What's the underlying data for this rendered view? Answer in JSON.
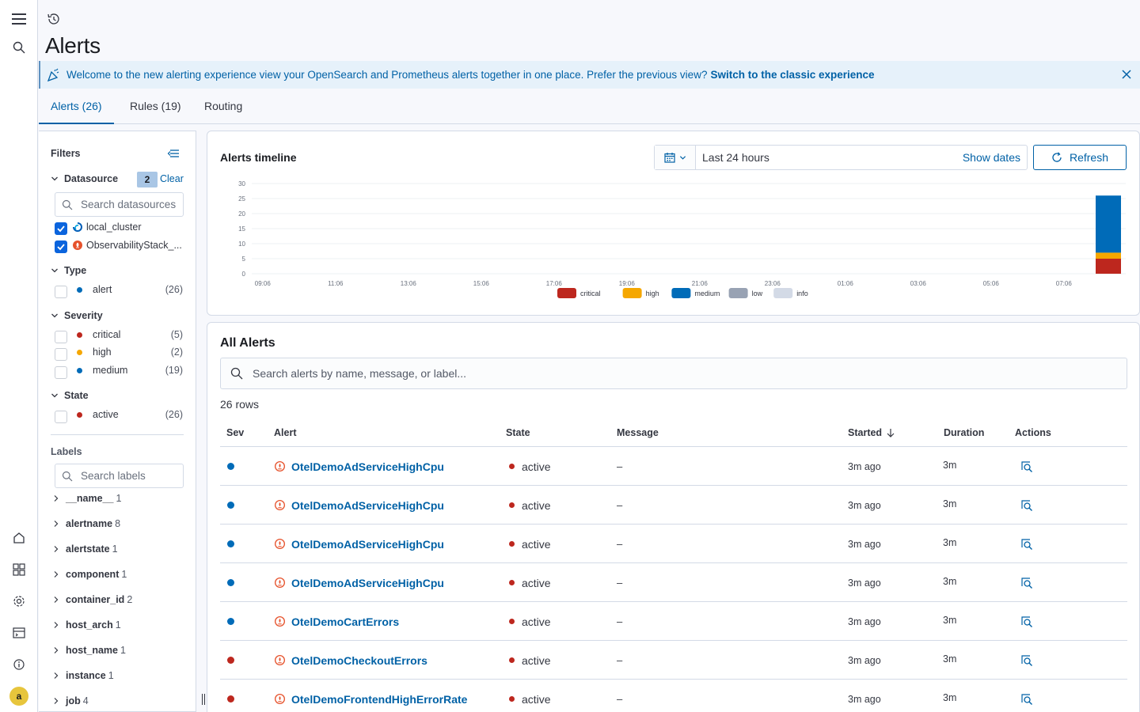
{
  "page": {
    "title": "Alerts"
  },
  "banner": {
    "message": "Welcome to the new alerting experience view your OpenSearch and Prometheus alerts together in one place. Prefer the previous view?",
    "link": "Switch to the classic experience"
  },
  "tabs": [
    {
      "label": "Alerts (26)",
      "active": true
    },
    {
      "label": "Rules (19)",
      "active": false
    },
    {
      "label": "Routing",
      "active": false
    }
  ],
  "filters": {
    "title": "Filters",
    "datasource": {
      "label": "Datasource",
      "selected_count": "2",
      "clear_label": "Clear",
      "search_placeholder": "Search datasources",
      "items": [
        {
          "label": "local_cluster",
          "checked": true,
          "icon": "opensearch-icon"
        },
        {
          "label": "ObservabilityStack_...",
          "checked": true,
          "icon": "prometheus-icon"
        }
      ]
    },
    "type": {
      "label": "Type",
      "items": [
        {
          "label": "alert",
          "count": "(26)",
          "color": "#006bb8"
        }
      ]
    },
    "severity": {
      "label": "Severity",
      "items": [
        {
          "label": "critical",
          "count": "(5)",
          "color": "#bd271e"
        },
        {
          "label": "high",
          "count": "(2)",
          "color": "#f5a700"
        },
        {
          "label": "medium",
          "count": "(19)",
          "color": "#006bb8"
        }
      ]
    },
    "state": {
      "label": "State",
      "items": [
        {
          "label": "active",
          "count": "(26)",
          "color": "#bd271e"
        }
      ]
    },
    "labels": {
      "title": "Labels",
      "search_placeholder": "Search labels",
      "items": [
        {
          "name": "__name__",
          "count": "1"
        },
        {
          "name": "alertname",
          "count": "8"
        },
        {
          "name": "alertstate",
          "count": "1"
        },
        {
          "name": "component",
          "count": "1"
        },
        {
          "name": "container_id",
          "count": "2"
        },
        {
          "name": "host_arch",
          "count": "1"
        },
        {
          "name": "host_name",
          "count": "1"
        },
        {
          "name": "instance",
          "count": "1"
        },
        {
          "name": "job",
          "count": "4"
        }
      ]
    }
  },
  "timeline": {
    "title": "Alerts timeline",
    "date_range": "Last 24 hours",
    "show_dates": "Show dates",
    "refresh": "Refresh"
  },
  "chart_data": {
    "type": "bar",
    "stacked": true,
    "yticks": [
      "0",
      "5",
      "10",
      "15",
      "20",
      "25",
      "30"
    ],
    "ylim": [
      0,
      30
    ],
    "xticks": [
      "09:06",
      "11:06",
      "13:06",
      "15:06",
      "17:06",
      "19:06",
      "21:06",
      "23:06",
      "01:06",
      "03:06",
      "05:06",
      "07:06"
    ],
    "grid": true,
    "legend_position": "bottom",
    "series": [
      {
        "name": "critical",
        "color": "#bd271e",
        "values": [
          5
        ]
      },
      {
        "name": "high",
        "color": "#f5a700",
        "values": [
          2
        ]
      },
      {
        "name": "medium",
        "color": "#006bb8",
        "values": [
          19
        ]
      },
      {
        "name": "low",
        "color": "#98a2b3",
        "values": [
          0
        ]
      },
      {
        "name": "info",
        "color": "#d3dae6",
        "values": [
          0
        ]
      }
    ],
    "bar_bucket_index": 23.5,
    "bucket_count": 24
  },
  "alerts": {
    "title": "All Alerts",
    "search_placeholder": "Search alerts by name, message, or label...",
    "row_count": "26 rows",
    "columns": [
      "Sev",
      "Alert",
      "State",
      "Message",
      "Started",
      "Duration",
      "Actions"
    ],
    "rows": [
      {
        "sev_color": "#006bb8",
        "name": "OtelDemoAdServiceHighCpu",
        "state": "active",
        "message": "–",
        "started": "3m ago",
        "duration": "3m"
      },
      {
        "sev_color": "#006bb8",
        "name": "OtelDemoAdServiceHighCpu",
        "state": "active",
        "message": "–",
        "started": "3m ago",
        "duration": "3m"
      },
      {
        "sev_color": "#006bb8",
        "name": "OtelDemoAdServiceHighCpu",
        "state": "active",
        "message": "–",
        "started": "3m ago",
        "duration": "3m"
      },
      {
        "sev_color": "#006bb8",
        "name": "OtelDemoAdServiceHighCpu",
        "state": "active",
        "message": "–",
        "started": "3m ago",
        "duration": "3m"
      },
      {
        "sev_color": "#006bb8",
        "name": "OtelDemoCartErrors",
        "state": "active",
        "message": "–",
        "started": "3m ago",
        "duration": "3m"
      },
      {
        "sev_color": "#bd271e",
        "name": "OtelDemoCheckoutErrors",
        "state": "active",
        "message": "–",
        "started": "3m ago",
        "duration": "3m"
      },
      {
        "sev_color": "#bd271e",
        "name": "OtelDemoFrontendHighErrorRate",
        "state": "active",
        "message": "–",
        "started": "3m ago",
        "duration": "3m"
      }
    ]
  },
  "user": {
    "avatar_letter": "a"
  }
}
